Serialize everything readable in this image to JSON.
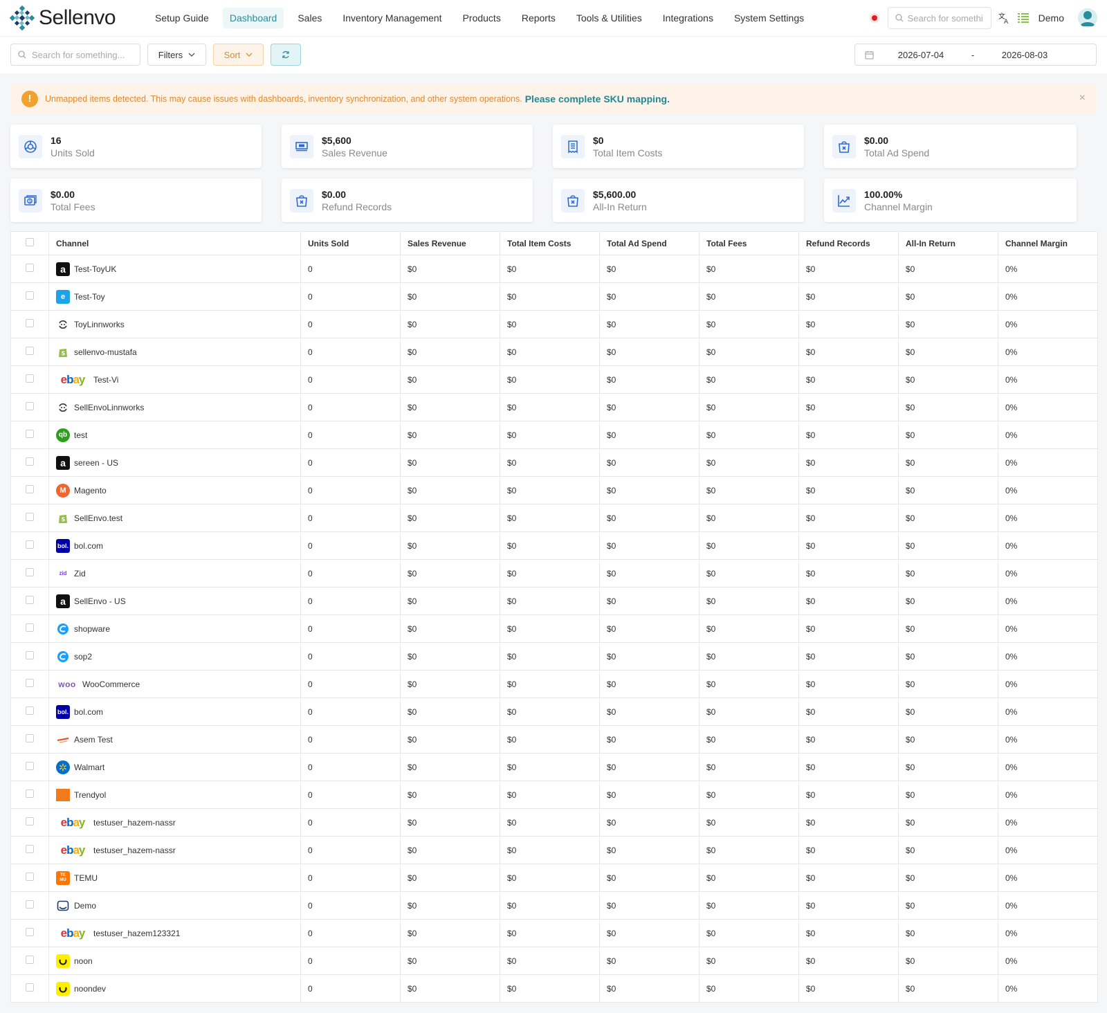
{
  "app": {
    "name": "Sellenvo"
  },
  "nav": {
    "items": [
      "Setup Guide",
      "Dashboard",
      "Sales",
      "Inventory Management",
      "Products",
      "Reports",
      "Tools & Utilities",
      "Integrations",
      "System Settings"
    ],
    "active": "Dashboard",
    "search_placeholder": "Search for somethi",
    "user": "Demo"
  },
  "toolbar": {
    "search_placeholder": "Search for something...",
    "filters_label": "Filters",
    "sort_label": "Sort",
    "date_from": "2026-07-04",
    "date_sep": "-",
    "date_to": "2026-08-03"
  },
  "alert": {
    "text": "Unmapped items detected. This may cause issues with dashboards, inventory synchronization, and other system operations.",
    "link": "Please complete SKU mapping.",
    "close": "×"
  },
  "stats": [
    {
      "value": "16",
      "label": "Units Sold",
      "icon": "units-icon"
    },
    {
      "value": "$5,600",
      "label": "Sales Revenue",
      "icon": "revenue-icon"
    },
    {
      "value": "$0",
      "label": "Total Item Costs",
      "icon": "receipt-icon"
    },
    {
      "value": "$0.00",
      "label": "Total Ad Spend",
      "icon": "bag-icon"
    },
    {
      "value": "$0.00",
      "label": "Total Fees",
      "icon": "fees-icon"
    },
    {
      "value": "$0.00",
      "label": "Refund Records",
      "icon": "bag-icon"
    },
    {
      "value": "$5,600.00",
      "label": "All-In Return",
      "icon": "bag-icon"
    },
    {
      "value": "100.00%",
      "label": "Channel Margin",
      "icon": "trend-icon"
    }
  ],
  "table": {
    "columns": [
      "Channel",
      "Units Sold",
      "Sales Revenue",
      "Total Item Costs",
      "Total Ad Spend",
      "Total Fees",
      "Refund Records",
      "All-In Return",
      "Channel Margin"
    ],
    "rows": [
      {
        "channel": "Test-ToyUK",
        "logo": "amazon",
        "units": "0",
        "revenue": "$0",
        "costs": "$0",
        "ad": "$0",
        "fees": "$0",
        "refunds": "$0",
        "return": "$0",
        "margin": "0%"
      },
      {
        "channel": "Test-Toy",
        "logo": "edge",
        "units": "0",
        "revenue": "$0",
        "costs": "$0",
        "ad": "$0",
        "fees": "$0",
        "refunds": "$0",
        "return": "$0",
        "margin": "0%"
      },
      {
        "channel": "ToyLinnworks",
        "logo": "linnworks",
        "units": "0",
        "revenue": "$0",
        "costs": "$0",
        "ad": "$0",
        "fees": "$0",
        "refunds": "$0",
        "return": "$0",
        "margin": "0%"
      },
      {
        "channel": "sellenvo-mustafa",
        "logo": "shopify",
        "units": "0",
        "revenue": "$0",
        "costs": "$0",
        "ad": "$0",
        "fees": "$0",
        "refunds": "$0",
        "return": "$0",
        "margin": "0%"
      },
      {
        "channel": "Test-Vi",
        "logo": "ebay",
        "units": "0",
        "revenue": "$0",
        "costs": "$0",
        "ad": "$0",
        "fees": "$0",
        "refunds": "$0",
        "return": "$0",
        "margin": "0%"
      },
      {
        "channel": "SellEnvoLinnworks",
        "logo": "linnworks",
        "units": "0",
        "revenue": "$0",
        "costs": "$0",
        "ad": "$0",
        "fees": "$0",
        "refunds": "$0",
        "return": "$0",
        "margin": "0%"
      },
      {
        "channel": "test",
        "logo": "quickbooks",
        "units": "0",
        "revenue": "$0",
        "costs": "$0",
        "ad": "$0",
        "fees": "$0",
        "refunds": "$0",
        "return": "$0",
        "margin": "0%"
      },
      {
        "channel": "sereen - US",
        "logo": "amazon",
        "units": "0",
        "revenue": "$0",
        "costs": "$0",
        "ad": "$0",
        "fees": "$0",
        "refunds": "$0",
        "return": "$0",
        "margin": "0%"
      },
      {
        "channel": "Magento",
        "logo": "magento",
        "units": "0",
        "revenue": "$0",
        "costs": "$0",
        "ad": "$0",
        "fees": "$0",
        "refunds": "$0",
        "return": "$0",
        "margin": "0%"
      },
      {
        "channel": "SellEnvo.test",
        "logo": "shopify",
        "units": "0",
        "revenue": "$0",
        "costs": "$0",
        "ad": "$0",
        "fees": "$0",
        "refunds": "$0",
        "return": "$0",
        "margin": "0%"
      },
      {
        "channel": "bol.com",
        "logo": "bol",
        "units": "0",
        "revenue": "$0",
        "costs": "$0",
        "ad": "$0",
        "fees": "$0",
        "refunds": "$0",
        "return": "$0",
        "margin": "0%"
      },
      {
        "channel": "Zid",
        "logo": "zid",
        "units": "0",
        "revenue": "$0",
        "costs": "$0",
        "ad": "$0",
        "fees": "$0",
        "refunds": "$0",
        "return": "$0",
        "margin": "0%"
      },
      {
        "channel": "SellEnvo - US",
        "logo": "amazon",
        "units": "0",
        "revenue": "$0",
        "costs": "$0",
        "ad": "$0",
        "fees": "$0",
        "refunds": "$0",
        "return": "$0",
        "margin": "0%"
      },
      {
        "channel": "shopware",
        "logo": "shopware",
        "units": "0",
        "revenue": "$0",
        "costs": "$0",
        "ad": "$0",
        "fees": "$0",
        "refunds": "$0",
        "return": "$0",
        "margin": "0%"
      },
      {
        "channel": "sop2",
        "logo": "shopware",
        "units": "0",
        "revenue": "$0",
        "costs": "$0",
        "ad": "$0",
        "fees": "$0",
        "refunds": "$0",
        "return": "$0",
        "margin": "0%"
      },
      {
        "channel": "WooCommerce",
        "logo": "woo",
        "units": "0",
        "revenue": "$0",
        "costs": "$0",
        "ad": "$0",
        "fees": "$0",
        "refunds": "$0",
        "return": "$0",
        "margin": "0%"
      },
      {
        "channel": "bol.com",
        "logo": "bol",
        "units": "0",
        "revenue": "$0",
        "costs": "$0",
        "ad": "$0",
        "fees": "$0",
        "refunds": "$0",
        "return": "$0",
        "margin": "0%"
      },
      {
        "channel": "Asem Test",
        "logo": "generic-orange",
        "units": "0",
        "revenue": "$0",
        "costs": "$0",
        "ad": "$0",
        "fees": "$0",
        "refunds": "$0",
        "return": "$0",
        "margin": "0%"
      },
      {
        "channel": "Walmart",
        "logo": "walmart",
        "units": "0",
        "revenue": "$0",
        "costs": "$0",
        "ad": "$0",
        "fees": "$0",
        "refunds": "$0",
        "return": "$0",
        "margin": "0%"
      },
      {
        "channel": "Trendyol",
        "logo": "trendyol",
        "units": "0",
        "revenue": "$0",
        "costs": "$0",
        "ad": "$0",
        "fees": "$0",
        "refunds": "$0",
        "return": "$0",
        "margin": "0%"
      },
      {
        "channel": "testuser_hazem-nassr",
        "logo": "ebay",
        "units": "0",
        "revenue": "$0",
        "costs": "$0",
        "ad": "$0",
        "fees": "$0",
        "refunds": "$0",
        "return": "$0",
        "margin": "0%"
      },
      {
        "channel": "testuser_hazem-nassr",
        "logo": "ebay",
        "units": "0",
        "revenue": "$0",
        "costs": "$0",
        "ad": "$0",
        "fees": "$0",
        "refunds": "$0",
        "return": "$0",
        "margin": "0%"
      },
      {
        "channel": "TEMU",
        "logo": "temu",
        "units": "0",
        "revenue": "$0",
        "costs": "$0",
        "ad": "$0",
        "fees": "$0",
        "refunds": "$0",
        "return": "$0",
        "margin": "0%"
      },
      {
        "channel": "Demo",
        "logo": "inbox",
        "units": "0",
        "revenue": "$0",
        "costs": "$0",
        "ad": "$0",
        "fees": "$0",
        "refunds": "$0",
        "return": "$0",
        "margin": "0%"
      },
      {
        "channel": "testuser_hazem123321",
        "logo": "ebay",
        "units": "0",
        "revenue": "$0",
        "costs": "$0",
        "ad": "$0",
        "fees": "$0",
        "refunds": "$0",
        "return": "$0",
        "margin": "0%"
      },
      {
        "channel": "noon",
        "logo": "noon",
        "units": "0",
        "revenue": "$0",
        "costs": "$0",
        "ad": "$0",
        "fees": "$0",
        "refunds": "$0",
        "return": "$0",
        "margin": "0%"
      },
      {
        "channel": "noondev",
        "logo": "noon",
        "units": "0",
        "revenue": "$0",
        "costs": "$0",
        "ad": "$0",
        "fees": "$0",
        "refunds": "$0",
        "return": "$0",
        "margin": "0%"
      }
    ]
  },
  "colors": {
    "accent": "#2a8d9c",
    "alert_bg": "#fdf3e8",
    "alert_text": "#e4882d",
    "card_icon": "#2d6ad6"
  }
}
